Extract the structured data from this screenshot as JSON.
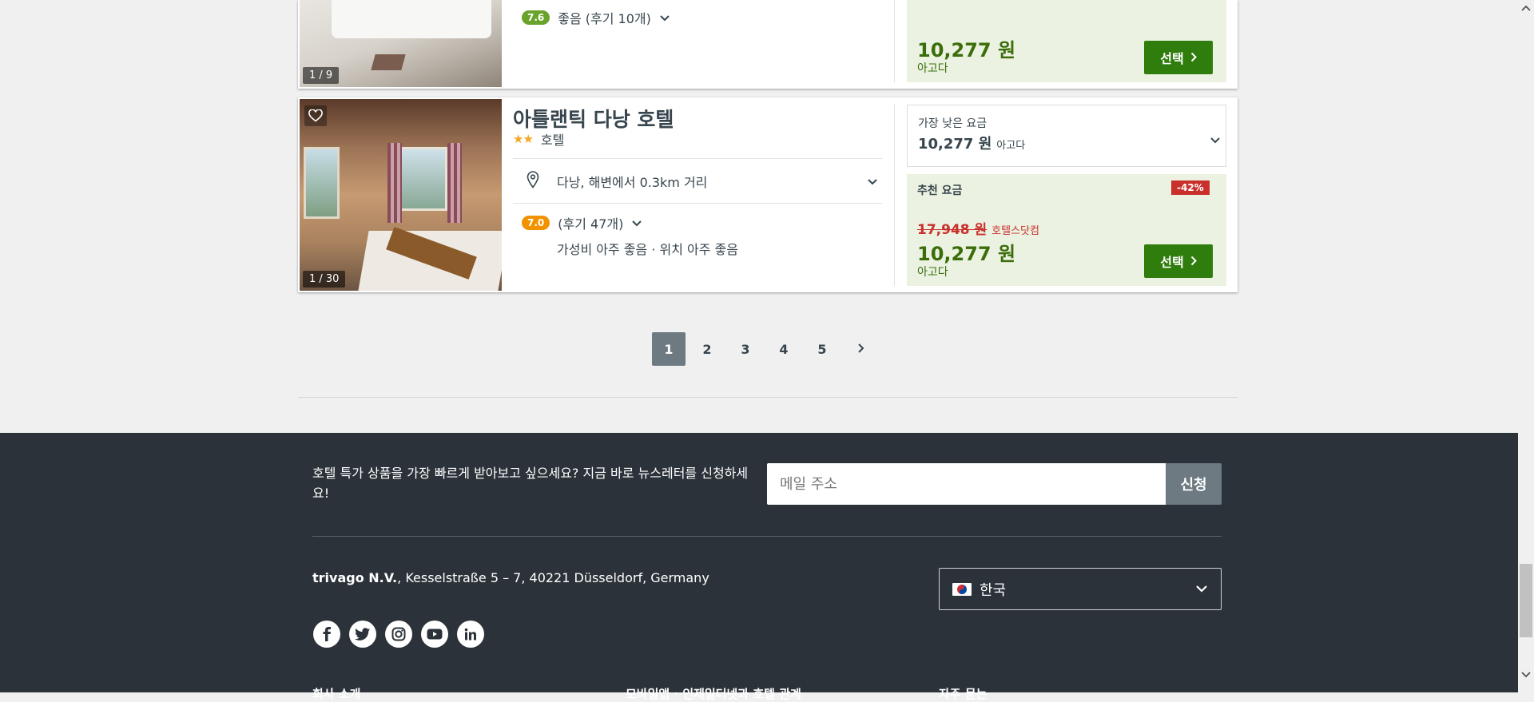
{
  "hotel_top": {
    "photo_count": "1 / 9",
    "rating": "7.6",
    "rating_text": "좋음 (후기 10개)",
    "price": "10,277 원",
    "provider": "아고다",
    "select_label": "선택"
  },
  "hotel_main": {
    "photo_count": "1 / 30",
    "name": "아틀랜틱 다낭 호텔",
    "stars": "★★",
    "type": "호텔",
    "location": "다낭, 해변에서 0.3km 거리",
    "rating": "7.0",
    "rating_text": "(후기 47개)",
    "highlights": "가성비 아주 좋음 · 위치 아주 좋음",
    "lowest_label": "가장 낮은 요금",
    "lowest_price": "10,277 원",
    "lowest_provider": "아고다",
    "recommended_label": "추천 요금",
    "discount": "-42%",
    "old_price": "17,948 원",
    "old_provider": "호텔스닷컴",
    "price": "10,277 원",
    "provider": "아고다",
    "select_label": "선택"
  },
  "pagination": {
    "pages": [
      "1",
      "2",
      "3",
      "4",
      "5"
    ],
    "current": "1"
  },
  "footer": {
    "newsletter_text": "호텔 특가 상품을 가장 빠르게 받아보고 싶으세요? 지금 바로 뉴스레터를 신청하세요!",
    "email_placeholder": "메일 주소",
    "subscribe_label": "신청",
    "company_name": "trivago N.V.",
    "company_address": ", Kesselstraße 5 – 7, 40221 Düsseldorf, Germany",
    "country": "한국",
    "bottom_links": [
      "회사 소개",
      "모바일앱 · 인제일터넷과 호텔 관계",
      "자주 묻는"
    ]
  },
  "colors": {
    "rating_green": "#6aa32b",
    "rating_orange": "#f39200",
    "select_green": "#2f7d0c",
    "price_green": "#3b6e0a",
    "discount_red": "#c9302c",
    "footer_bg": "#2b3239"
  }
}
